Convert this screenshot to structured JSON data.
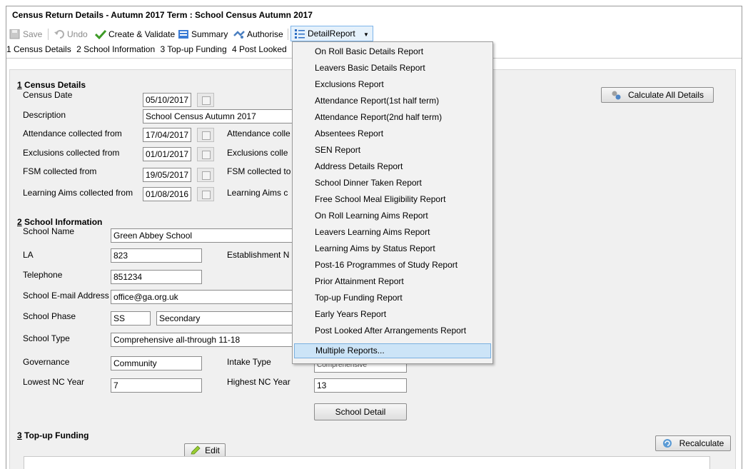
{
  "window": {
    "title": "Census Return Details - Autumn 2017 Term : School Census Autumn 2017"
  },
  "toolbar": {
    "save": "Save",
    "undo": "Undo",
    "create_validate": "Create & Validate",
    "summary": "Summary",
    "authorise": "Authorise",
    "detail_report": "DetailReport"
  },
  "tabs": [
    "1 Census Details",
    "2 School Information",
    "3 Top-up Funding",
    "4 Post Looked"
  ],
  "census_details": {
    "heading_num": "1",
    "heading_text": " Census Details",
    "census_date_label": "Census Date",
    "census_date": "05/10/2017",
    "description_label": "Description",
    "description": "School Census Autumn 2017",
    "attendance_from_label": "Attendance collected from",
    "attendance_from": "17/04/2017",
    "attendance_to_label": "Attendance colle",
    "exclusions_from_label": "Exclusions collected from",
    "exclusions_from": "01/01/2017",
    "exclusions_to_label": "Exclusions colle",
    "fsm_from_label": "FSM collected from",
    "fsm_from": "19/05/2017",
    "fsm_to_label": "FSM collected to",
    "learning_from_label": "Learning Aims collected from",
    "learning_from": "01/08/2016",
    "learning_to_label": "Learning Aims c",
    "calculate_all": "Calculate All Details"
  },
  "school_info": {
    "heading_num": "2",
    "heading_text": " School Information",
    "school_name_label": "School Name",
    "school_name": "Green Abbey School",
    "la_label": "LA",
    "la": "823",
    "establishment_label": "Establishment N",
    "telephone_label": "Telephone",
    "telephone": "851234",
    "email_label": "School E-mail Address",
    "email": "office@ga.org.uk",
    "phase_label": "School Phase",
    "phase_code": "SS",
    "phase": "Secondary",
    "type_label": "School Type",
    "type": "Comprehensive all-through 11-18",
    "governance_label": "Governance",
    "governance": "Community",
    "intake_label": "Intake Type",
    "intake": "Comprehensive",
    "lowest_label": "Lowest NC Year",
    "lowest": "7",
    "highest_label": "Highest NC Year",
    "highest": "13",
    "school_detail": "School Detail"
  },
  "topup": {
    "heading_num": "3",
    "heading_text": " Top-up Funding",
    "edit": "Edit",
    "recalculate": "Recalculate"
  },
  "detail_menu": {
    "items": [
      "On Roll Basic Details Report",
      "Leavers Basic Details Report",
      "Exclusions Report",
      "Attendance Report(1st half term)",
      "Attendance Report(2nd half term)",
      "Absentees Report",
      "SEN Report",
      "Address Details Report",
      "School Dinner Taken Report",
      "Free School Meal Eligibility Report",
      "On Roll Learning Aims Report",
      "Leavers Learning Aims Report",
      "Learning Aims by Status Report",
      "Post-16 Programmes of Study Report",
      "Prior Attainment Report",
      "Top-up Funding Report",
      "Early Years Report",
      "Post Looked After Arrangements Report",
      "Multiple Reports..."
    ],
    "selected": "Multiple Reports..."
  }
}
